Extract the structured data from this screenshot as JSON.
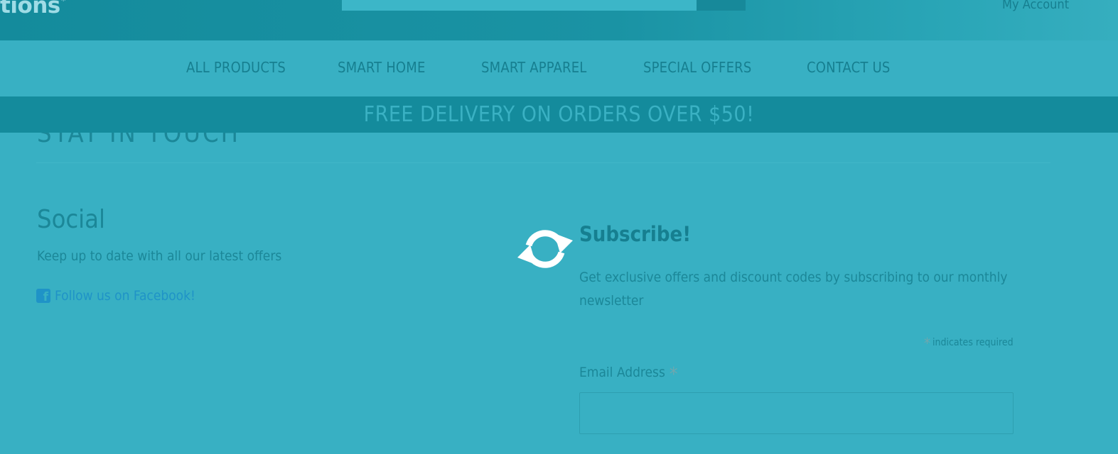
{
  "header": {
    "logo_text": "tions",
    "search_placeholder": "",
    "account_label": "My Account"
  },
  "nav": {
    "items": [
      {
        "label": "ALL PRODUCTS"
      },
      {
        "label": "SMART HOME"
      },
      {
        "label": "SMART APPAREL"
      },
      {
        "label": "SPECIAL OFFERS"
      },
      {
        "label": "CONTACT US"
      }
    ]
  },
  "promo": {
    "text": "FREE DELIVERY ON ORDERS OVER $50!"
  },
  "section": {
    "heading": "STAY IN TOUCH"
  },
  "social": {
    "title": "Social",
    "text": "Keep up to date with all our latest offers",
    "facebook_link": "Follow us on Facebook!"
  },
  "subscribe": {
    "title": "Subscribe!",
    "description": "Get exclusive offers and discount codes by subscribing to our monthly newsletter",
    "required_star": "*",
    "required_note": "indicates required",
    "email_label": "Email Address",
    "email_value": ""
  },
  "colors": {
    "overlay": "#38b0c3",
    "header_dark": "#148b9c",
    "text_dark": "#167f90",
    "link": "#1f93c7",
    "spinner": "#ffffff"
  },
  "icons": {
    "loading": "refresh-icon",
    "facebook": "facebook-square-icon"
  }
}
